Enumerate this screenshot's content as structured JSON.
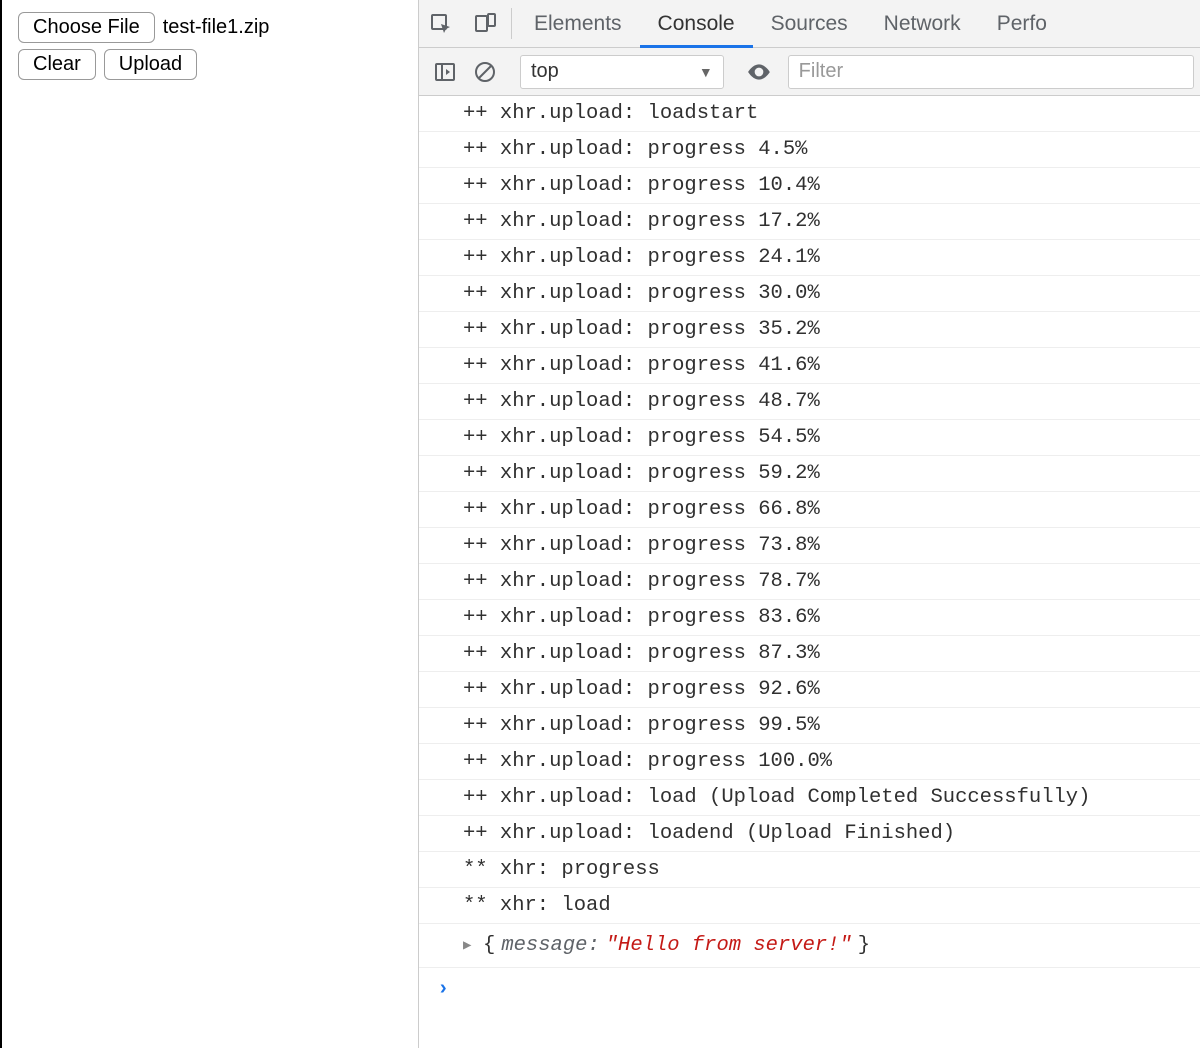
{
  "page": {
    "choose_file_label": "Choose File",
    "filename": "test-file1.zip",
    "clear_label": "Clear",
    "upload_label": "Upload"
  },
  "devtools": {
    "tabs": {
      "elements": "Elements",
      "console": "Console",
      "sources": "Sources",
      "network": "Network",
      "performance": "Perfo"
    },
    "toolbar": {
      "context": "top",
      "filter_placeholder": "Filter"
    },
    "logs": [
      "++ xhr.upload: loadstart",
      "++ xhr.upload: progress 4.5%",
      "++ xhr.upload: progress 10.4%",
      "++ xhr.upload: progress 17.2%",
      "++ xhr.upload: progress 24.1%",
      "++ xhr.upload: progress 30.0%",
      "++ xhr.upload: progress 35.2%",
      "++ xhr.upload: progress 41.6%",
      "++ xhr.upload: progress 48.7%",
      "++ xhr.upload: progress 54.5%",
      "++ xhr.upload: progress 59.2%",
      "++ xhr.upload: progress 66.8%",
      "++ xhr.upload: progress 73.8%",
      "++ xhr.upload: progress 78.7%",
      "++ xhr.upload: progress 83.6%",
      "++ xhr.upload: progress 87.3%",
      "++ xhr.upload: progress 92.6%",
      "++ xhr.upload: progress 99.5%",
      "++ xhr.upload: progress 100.0%",
      "++ xhr.upload: load (Upload Completed Successfully)",
      "++ xhr.upload: loadend (Upload Finished)",
      "** xhr: progress",
      "** xhr: load"
    ],
    "object_log": {
      "key": "message",
      "value": "\"Hello from server!\""
    },
    "prompt": "›"
  }
}
